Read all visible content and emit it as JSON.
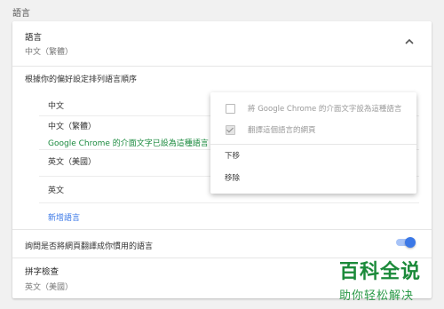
{
  "section_title": "語言",
  "language": {
    "title": "語言",
    "current": "中文（繁體）"
  },
  "order_label": "根據你的偏好設定排列語言順序",
  "languages": [
    {
      "name": "中文"
    },
    {
      "name": "中文（繁體）",
      "note": "Google Chrome 的介面文字已設為這種語言"
    },
    {
      "name": "英文（美國）"
    },
    {
      "name": "英文"
    }
  ],
  "add_language": "新增語言",
  "offer_translate_label": "詢問是否將網頁翻譯成你慣用的語言",
  "offer_translate_enabled": true,
  "spellcheck": {
    "title": "拼字檢查",
    "value": "英文（美國）"
  },
  "menu": {
    "display_in_language": "將 Google Chrome 的介面文字設為這種語言",
    "offer_translate": "翻譯這個語言的網頁",
    "offer_translate_checked": true,
    "move_down": "下移",
    "remove": "移除"
  },
  "colors": {
    "accent": "#3b78e7",
    "note_green": "#1a8a3e"
  },
  "watermark": {
    "line1": "百科全说",
    "line2": "助你轻松解决"
  }
}
